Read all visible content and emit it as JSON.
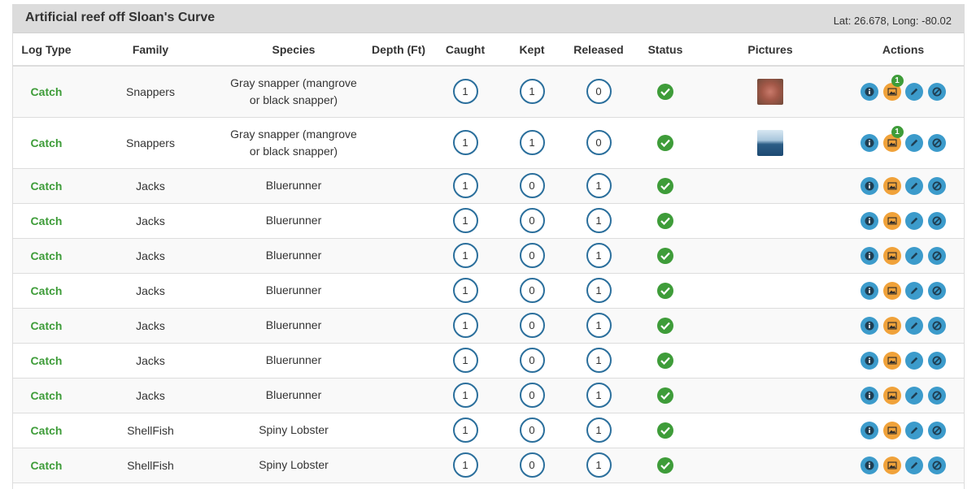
{
  "panel": {
    "title": "Artificial reef off Sloan's Curve",
    "coords": "Lat: 26.678, Long: -80.02"
  },
  "columns": [
    "Log Type",
    "Family",
    "Species",
    "Depth (Ft)",
    "Caught",
    "Kept",
    "Released",
    "Status",
    "Pictures",
    "Actions"
  ],
  "rows": [
    {
      "log_type": "Catch",
      "family": "Snappers",
      "species_line1": "Gray snapper (mangrove",
      "species_line2": "or black snapper)",
      "depth": "",
      "caught": "1",
      "kept": "1",
      "released": "0",
      "picture": "fish-photo",
      "photo_count": "1"
    },
    {
      "log_type": "Catch",
      "family": "Snappers",
      "species_line1": "Gray snapper (mangrove",
      "species_line2": "or black snapper)",
      "depth": "",
      "caught": "1",
      "kept": "1",
      "released": "0",
      "picture": "ocean-photo",
      "photo_count": "1"
    },
    {
      "log_type": "Catch",
      "family": "Jacks",
      "species_line1": "Bluerunner",
      "species_line2": "",
      "depth": "",
      "caught": "1",
      "kept": "0",
      "released": "1",
      "picture": "",
      "photo_count": ""
    },
    {
      "log_type": "Catch",
      "family": "Jacks",
      "species_line1": "Bluerunner",
      "species_line2": "",
      "depth": "",
      "caught": "1",
      "kept": "0",
      "released": "1",
      "picture": "",
      "photo_count": ""
    },
    {
      "log_type": "Catch",
      "family": "Jacks",
      "species_line1": "Bluerunner",
      "species_line2": "",
      "depth": "",
      "caught": "1",
      "kept": "0",
      "released": "1",
      "picture": "",
      "photo_count": ""
    },
    {
      "log_type": "Catch",
      "family": "Jacks",
      "species_line1": "Bluerunner",
      "species_line2": "",
      "depth": "",
      "caught": "1",
      "kept": "0",
      "released": "1",
      "picture": "",
      "photo_count": ""
    },
    {
      "log_type": "Catch",
      "family": "Jacks",
      "species_line1": "Bluerunner",
      "species_line2": "",
      "depth": "",
      "caught": "1",
      "kept": "0",
      "released": "1",
      "picture": "",
      "photo_count": ""
    },
    {
      "log_type": "Catch",
      "family": "Jacks",
      "species_line1": "Bluerunner",
      "species_line2": "",
      "depth": "",
      "caught": "1",
      "kept": "0",
      "released": "1",
      "picture": "",
      "photo_count": ""
    },
    {
      "log_type": "Catch",
      "family": "Jacks",
      "species_line1": "Bluerunner",
      "species_line2": "",
      "depth": "",
      "caught": "1",
      "kept": "0",
      "released": "1",
      "picture": "",
      "photo_count": ""
    },
    {
      "log_type": "Catch",
      "family": "ShellFish",
      "species_line1": "Spiny Lobster",
      "species_line2": "",
      "depth": "",
      "caught": "1",
      "kept": "0",
      "released": "1",
      "picture": "",
      "photo_count": ""
    },
    {
      "log_type": "Catch",
      "family": "ShellFish",
      "species_line1": "Spiny Lobster",
      "species_line2": "",
      "depth": "",
      "caught": "1",
      "kept": "0",
      "released": "1",
      "picture": "",
      "photo_count": ""
    }
  ],
  "icons": {
    "status": "check-circle-icon",
    "info": "info-icon",
    "pictures": "picture-icon",
    "edit": "pencil-icon",
    "cancel": "ban-icon"
  },
  "colors": {
    "log_type": "#3e9c39",
    "status_ok": "#3e9c39",
    "action_blue": "#3c9bcb",
    "action_orange": "#f0a23a",
    "count_ring": "#2b6f9c"
  }
}
